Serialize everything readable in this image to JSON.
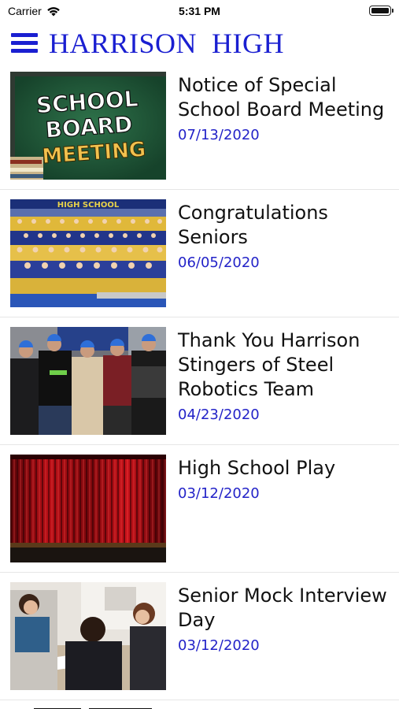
{
  "status_bar": {
    "carrier": "Carrier",
    "time": "5:31 PM"
  },
  "header": {
    "title": "HARRISON  HIGH"
  },
  "news": [
    {
      "title": "Notice of Special School Board Meeting",
      "date": "07/13/2020",
      "image_text": [
        "SCHOOL",
        "BOARD",
        "MEETING"
      ]
    },
    {
      "title": "Congratulations Seniors",
      "date": "06/05/2020",
      "image_text": [
        "HIGH SCHOOL"
      ]
    },
    {
      "title": "Thank You Harrison Stingers of Steel Robotics Team",
      "date": "04/23/2020",
      "image_text": []
    },
    {
      "title": "High School Play",
      "date": "03/12/2020",
      "image_text": []
    },
    {
      "title": "Senior Mock Interview Day",
      "date": "03/12/2020",
      "image_text": []
    }
  ]
}
